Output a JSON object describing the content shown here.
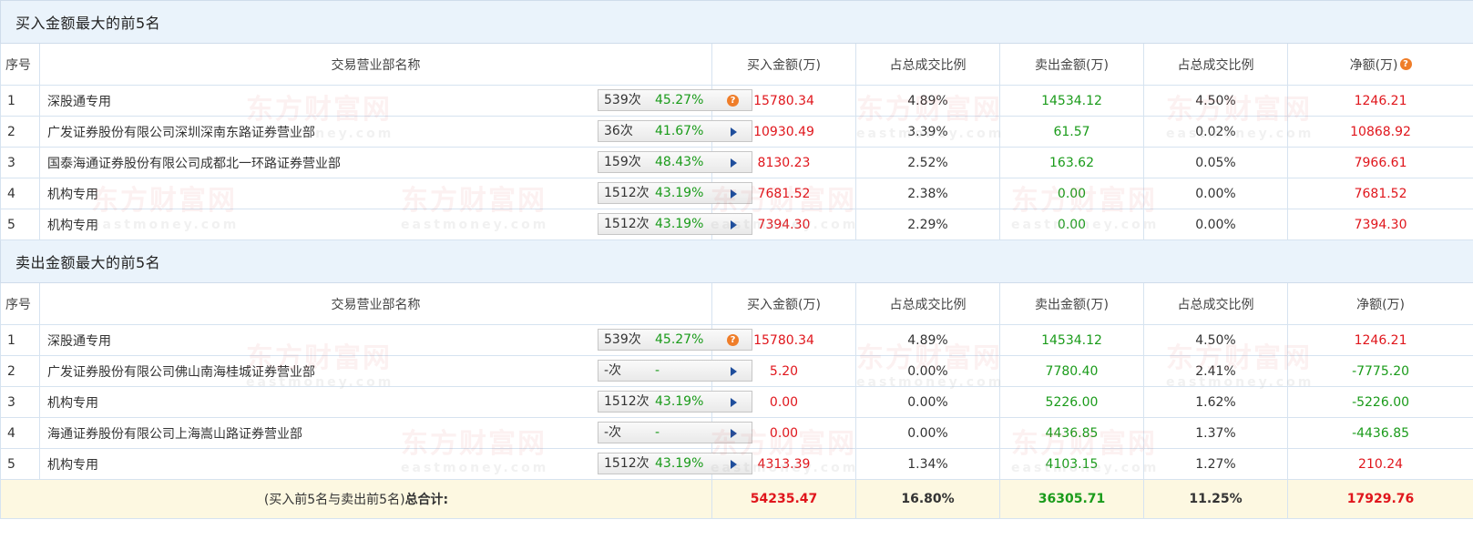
{
  "buy_section": {
    "title": "买入金额最大的前5名",
    "headers": [
      "序号",
      "交易营业部名称",
      "买入金额(万)",
      "占总成交比例",
      "卖出金额(万)",
      "占总成交比例",
      "净额(万)"
    ],
    "rows": [
      {
        "seq": "1",
        "name": "深股通专用",
        "count": "539次",
        "pct": "45.27%",
        "icon": "question",
        "buy": "15780.34",
        "buy_ratio": "4.89%",
        "sell": "14534.12",
        "sell_ratio": "4.50%",
        "net": "1246.21"
      },
      {
        "seq": "2",
        "name": "广发证券股份有限公司深圳深南东路证券营业部",
        "count": "36次",
        "pct": "41.67%",
        "icon": "arrow",
        "buy": "10930.49",
        "buy_ratio": "3.39%",
        "sell": "61.57",
        "sell_ratio": "0.02%",
        "net": "10868.92"
      },
      {
        "seq": "3",
        "name": "国泰海通证券股份有限公司成都北一环路证券营业部",
        "count": "159次",
        "pct": "48.43%",
        "icon": "arrow",
        "buy": "8130.23",
        "buy_ratio": "2.52%",
        "sell": "163.62",
        "sell_ratio": "0.05%",
        "net": "7966.61"
      },
      {
        "seq": "4",
        "name": "机构专用",
        "count": "1512次",
        "pct": "43.19%",
        "icon": "arrow",
        "buy": "7681.52",
        "buy_ratio": "2.38%",
        "sell": "0.00",
        "sell_ratio": "0.00%",
        "net": "7681.52"
      },
      {
        "seq": "5",
        "name": "机构专用",
        "count": "1512次",
        "pct": "43.19%",
        "icon": "arrow",
        "buy": "7394.30",
        "buy_ratio": "2.29%",
        "sell": "0.00",
        "sell_ratio": "0.00%",
        "net": "7394.30"
      }
    ]
  },
  "sell_section": {
    "title": "卖出金额最大的前5名",
    "headers": [
      "序号",
      "交易营业部名称",
      "买入金额(万)",
      "占总成交比例",
      "卖出金额(万)",
      "占总成交比例",
      "净额(万)"
    ],
    "rows": [
      {
        "seq": "1",
        "name": "深股通专用",
        "count": "539次",
        "pct": "45.27%",
        "icon": "question",
        "buy": "15780.34",
        "buy_ratio": "4.89%",
        "sell": "14534.12",
        "sell_ratio": "4.50%",
        "net": "1246.21"
      },
      {
        "seq": "2",
        "name": "广发证券股份有限公司佛山南海桂城证券营业部",
        "count": "-次",
        "pct": "-",
        "icon": "arrow",
        "buy": "5.20",
        "buy_ratio": "0.00%",
        "sell": "7780.40",
        "sell_ratio": "2.41%",
        "net": "-7775.20"
      },
      {
        "seq": "3",
        "name": "机构专用",
        "count": "1512次",
        "pct": "43.19%",
        "icon": "arrow",
        "buy": "0.00",
        "buy_ratio": "0.00%",
        "sell": "5226.00",
        "sell_ratio": "1.62%",
        "net": "-5226.00"
      },
      {
        "seq": "4",
        "name": "海通证券股份有限公司上海嵩山路证券营业部",
        "count": "-次",
        "pct": "-",
        "icon": "arrow",
        "buy": "0.00",
        "buy_ratio": "0.00%",
        "sell": "4436.85",
        "sell_ratio": "1.37%",
        "net": "-4436.85"
      },
      {
        "seq": "5",
        "name": "机构专用",
        "count": "1512次",
        "pct": "43.19%",
        "icon": "arrow",
        "buy": "4313.39",
        "buy_ratio": "1.34%",
        "sell": "4103.15",
        "sell_ratio": "1.27%",
        "net": "210.24"
      }
    ]
  },
  "total": {
    "label_prefix": "(买入前5名与卖出前5名)",
    "label_bold": "总合计:",
    "buy": "54235.47",
    "buy_ratio": "16.80%",
    "sell": "36305.71",
    "sell_ratio": "11.25%",
    "net": "17929.76"
  },
  "watermark": {
    "cn": "东方财富网",
    "en": "eastmoney.com"
  },
  "colors": {
    "buy": "#e0161c",
    "sell": "#1a9b1a",
    "section_bg": "#eaf3fb",
    "total_bg": "#fdf8e1",
    "help_icon": "#ef7d29",
    "arrow": "#1f4e9c"
  }
}
